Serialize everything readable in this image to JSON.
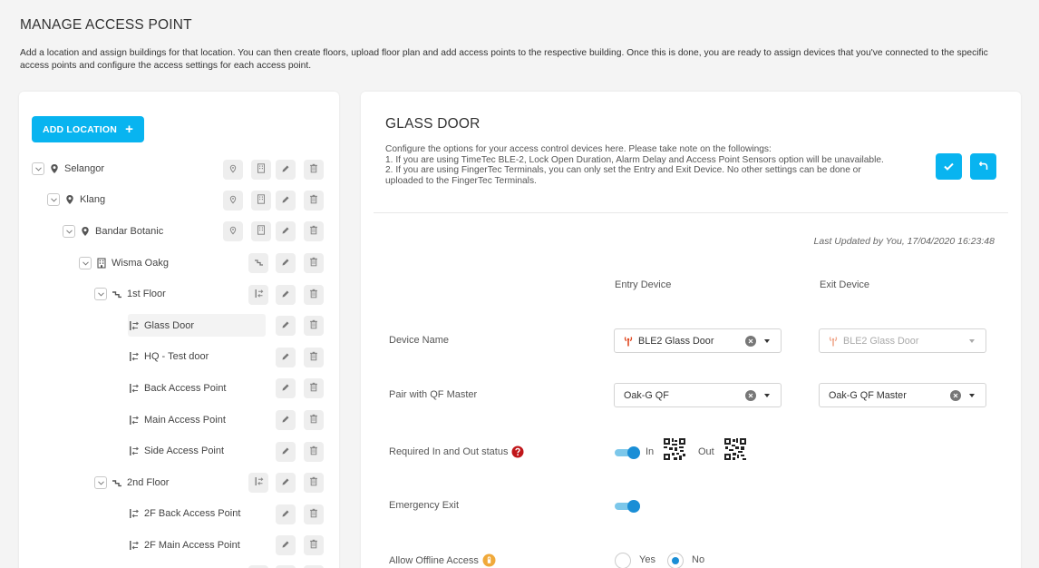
{
  "page": {
    "title": "MANAGE ACCESS POINT",
    "description": "Add a location and assign buildings for that location. You can then create floors, upload floor plan and add access points to the respective building. Once this is done, you are ready to assign devices that you've connected to the specific access points and configure the access settings for each access point."
  },
  "tree": {
    "add_location_label": "ADD LOCATION",
    "items": [
      {
        "label": "Selangor",
        "type": "location"
      },
      {
        "label": "Klang",
        "type": "location"
      },
      {
        "label": "Bandar Botanic",
        "type": "location"
      },
      {
        "label": "Wisma Oakg",
        "type": "building"
      },
      {
        "label": "1st Floor",
        "type": "floor"
      },
      {
        "label": "Glass Door",
        "type": "access-point",
        "selected": true
      },
      {
        "label": "HQ - Test door",
        "type": "access-point"
      },
      {
        "label": "Back Access Point",
        "type": "access-point"
      },
      {
        "label": "Main Access Point",
        "type": "access-point"
      },
      {
        "label": "Side Access Point",
        "type": "access-point"
      },
      {
        "label": "2nd Floor",
        "type": "floor"
      },
      {
        "label": "2F Back Access Point",
        "type": "access-point"
      },
      {
        "label": "2F Main Access Point",
        "type": "access-point"
      }
    ]
  },
  "detail": {
    "title": "GLASS DOOR",
    "description_lines": [
      "Configure the options for your access control devices here. Please take note on the followings:",
      "1. If you are using TimeTec BLE-2, Lock Open Duration, Alarm Delay and Access Point Sensors option will be unavailable.",
      "2. If you are using FingerTec Terminals, you can only set the Entry and Exit Device. No other settings can be done or",
      "uploaded to the FingerTec Terminals."
    ],
    "last_updated": "Last Updated by You, 17/04/2020 16:23:48",
    "entry_header": "Entry Device",
    "exit_header": "Exit Device",
    "device_name_label": "Device Name",
    "entry_device_value": "BLE2 Glass Door",
    "exit_device_value": "BLE2 Glass Door",
    "pair_label": "Pair with QF Master",
    "entry_pair_value": "Oak-G QF",
    "exit_pair_value": "Oak-G QF Master",
    "inout_label": "Required In and Out status",
    "in_label": "In",
    "out_label": "Out",
    "emergency_label": "Emergency Exit",
    "offline_label": "Allow Offline Access",
    "yes_label": "Yes",
    "no_label": "No",
    "offline_value": "No",
    "inout_on": true,
    "emergency_on": true
  },
  "colors": {
    "accent": "#08b4f0",
    "toggle": "#1a8ed6",
    "help": "#c0161a",
    "warn": "#f0a93a"
  }
}
